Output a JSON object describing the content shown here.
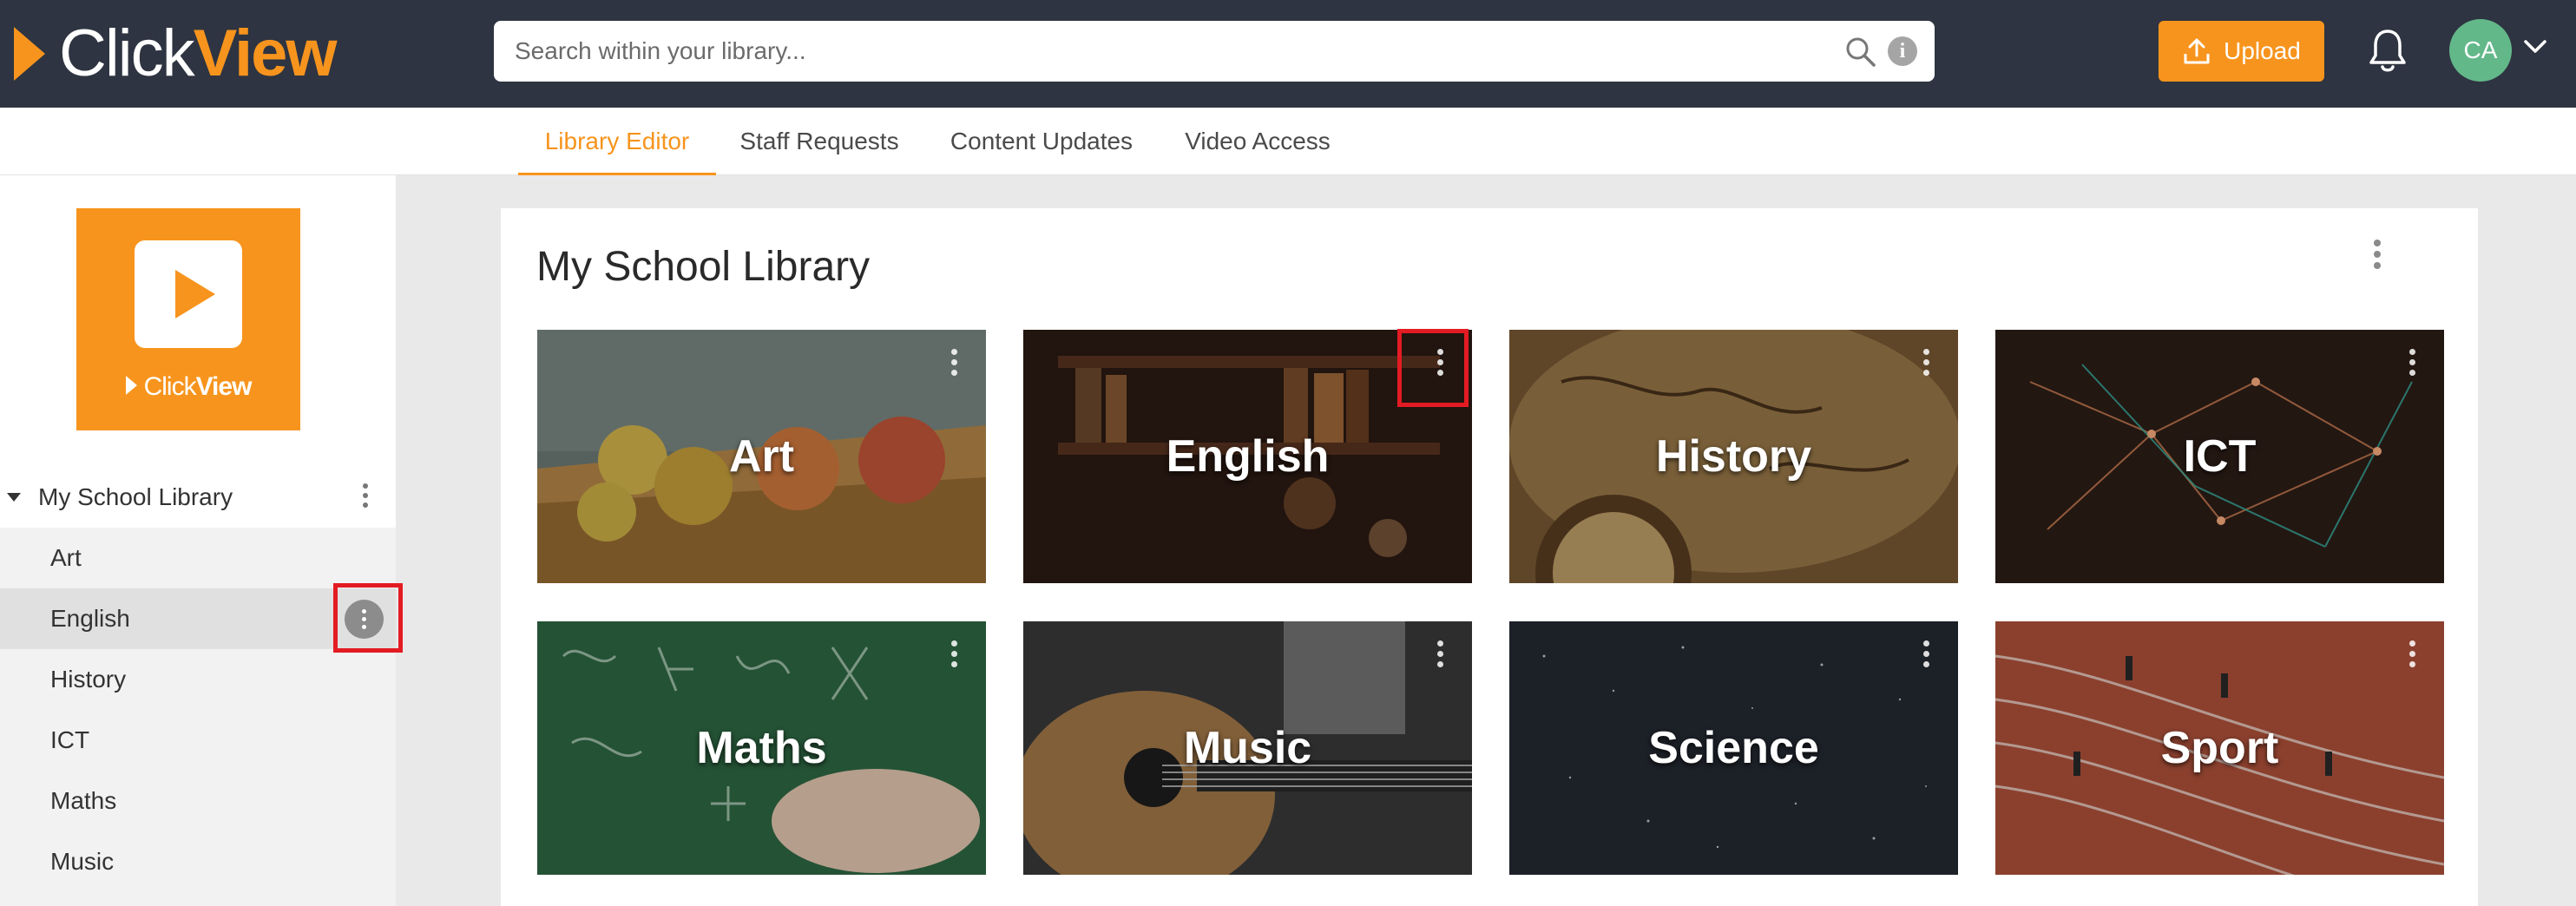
{
  "header": {
    "logo_click": "Click",
    "logo_view": "View",
    "search_placeholder": "Search within your library...",
    "upload_label": "Upload",
    "avatar_initials": "CA"
  },
  "tabs": [
    {
      "label": "Library Editor",
      "active": true
    },
    {
      "label": "Staff Requests",
      "active": false
    },
    {
      "label": "Content Updates",
      "active": false
    },
    {
      "label": "Video Access",
      "active": false
    }
  ],
  "sidebar": {
    "logo_mini_click": "Click",
    "logo_mini_view": "View",
    "root_label": "My School Library",
    "items": [
      {
        "label": "Art",
        "active": false
      },
      {
        "label": "English",
        "active": true
      },
      {
        "label": "History",
        "active": false
      },
      {
        "label": "ICT",
        "active": false
      },
      {
        "label": "Maths",
        "active": false
      },
      {
        "label": "Music",
        "active": false
      }
    ]
  },
  "main": {
    "title": "My School Library",
    "tiles": [
      {
        "label": "Art"
      },
      {
        "label": "English"
      },
      {
        "label": "History"
      },
      {
        "label": "ICT"
      },
      {
        "label": "Maths"
      },
      {
        "label": "Music"
      },
      {
        "label": "Science"
      },
      {
        "label": "Sport"
      }
    ]
  },
  "colors": {
    "accent": "#f7941d",
    "header_bg": "#2e3441",
    "avatar_bg": "#63b88a",
    "highlight": "#e31b23"
  },
  "icons": [
    "search-icon",
    "info-icon",
    "upload-icon",
    "bell-icon",
    "chevron-down-icon",
    "caret-down-icon",
    "more-vertical-icon",
    "play-icon"
  ]
}
